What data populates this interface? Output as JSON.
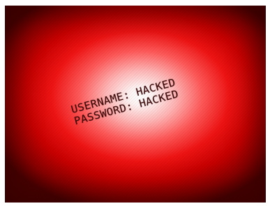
{
  "message": {
    "username_line": "USERNAME: HACKED",
    "password_line": "PASSWORD: HACKED"
  },
  "colors": {
    "background_center": "#ffffff",
    "background_mid": "#f01414",
    "background_edge": "#4a0000",
    "text": "#3a0505"
  }
}
